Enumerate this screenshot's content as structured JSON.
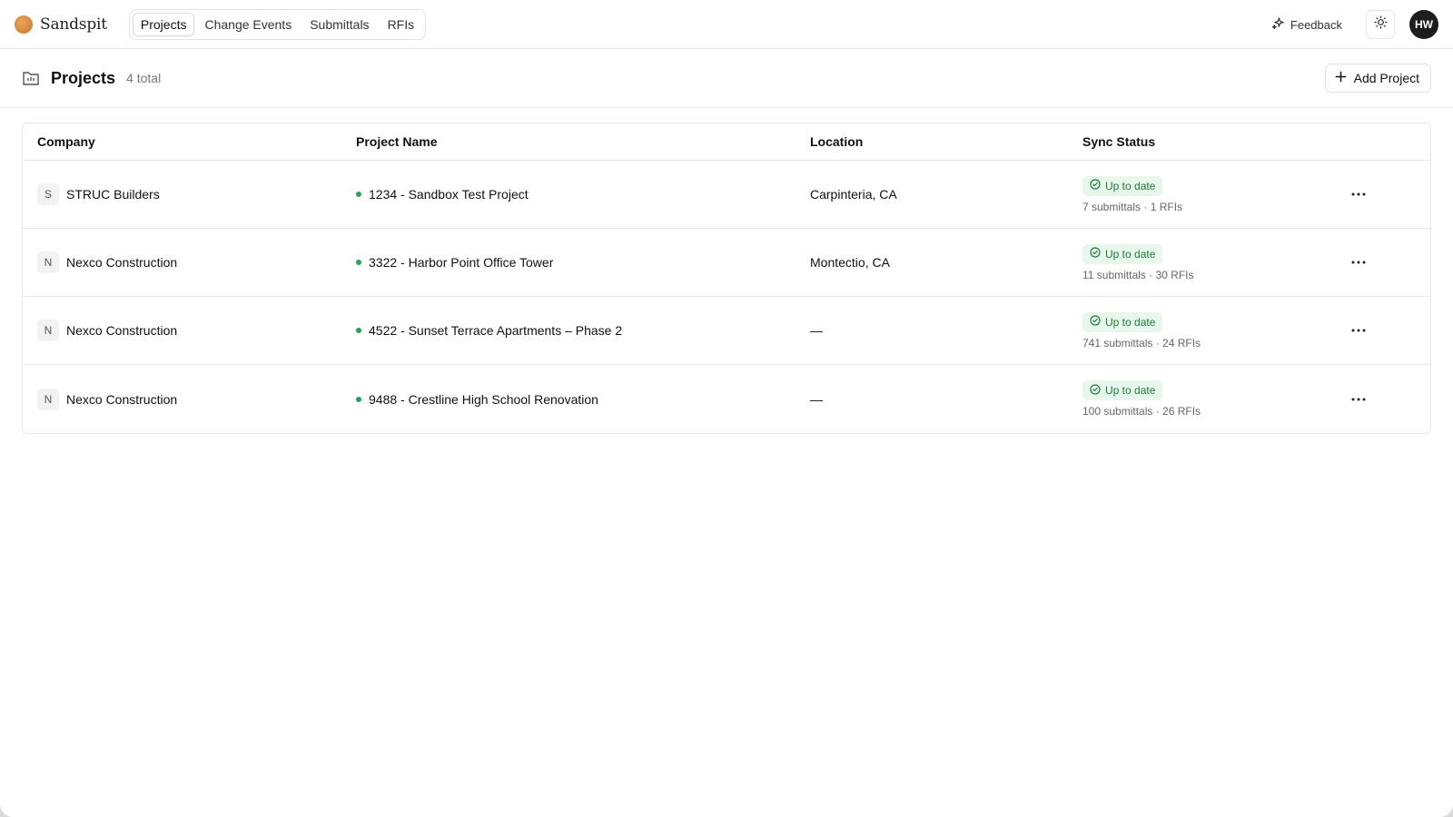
{
  "brand": {
    "name": "Sandspit"
  },
  "nav": {
    "tabs": [
      {
        "label": "Projects",
        "active": true
      },
      {
        "label": "Change Events",
        "active": false
      },
      {
        "label": "Submittals",
        "active": false
      },
      {
        "label": "RFIs",
        "active": false
      }
    ],
    "feedback_label": "Feedback",
    "avatar_initials": "HW"
  },
  "page": {
    "title": "Projects",
    "count": "4 total",
    "add_button_label": "Add Project"
  },
  "table": {
    "headers": {
      "company": "Company",
      "project": "Project Name",
      "location": "Location",
      "sync": "Sync Status"
    },
    "rows": [
      {
        "initial": "S",
        "company": "STRUC Builders",
        "project": "1234 - Sandbox Test Project",
        "location": "Carpinteria, CA",
        "status": "Up to date",
        "detail": "7 submittals · 1 RFIs"
      },
      {
        "initial": "N",
        "company": "Nexco Construction",
        "project": "3322 - Harbor Point Office Tower",
        "location": "Montectio, CA",
        "status": "Up to date",
        "detail": "11 submittals · 30 RFIs"
      },
      {
        "initial": "N",
        "company": "Nexco Construction",
        "project": "4522 - Sunset Terrace Apartments – Phase 2",
        "location": "—",
        "status": "Up to date",
        "detail": "741 submittals · 24 RFIs"
      },
      {
        "initial": "N",
        "company": "Nexco Construction",
        "project": "9488 - Crestline High School Renovation",
        "location": "—",
        "status": "Up to date",
        "detail": "100 submittals · 26 RFIs"
      }
    ]
  },
  "colors": {
    "status_green": "#22a55a",
    "badge_bg": "#e8f7ec",
    "avatar_bg": "#1d1d1d"
  },
  "icons": [
    "sparkle-icon",
    "sun-icon",
    "folder-icon",
    "plus-icon",
    "check-circle-icon",
    "more-horizontal-icon"
  ]
}
